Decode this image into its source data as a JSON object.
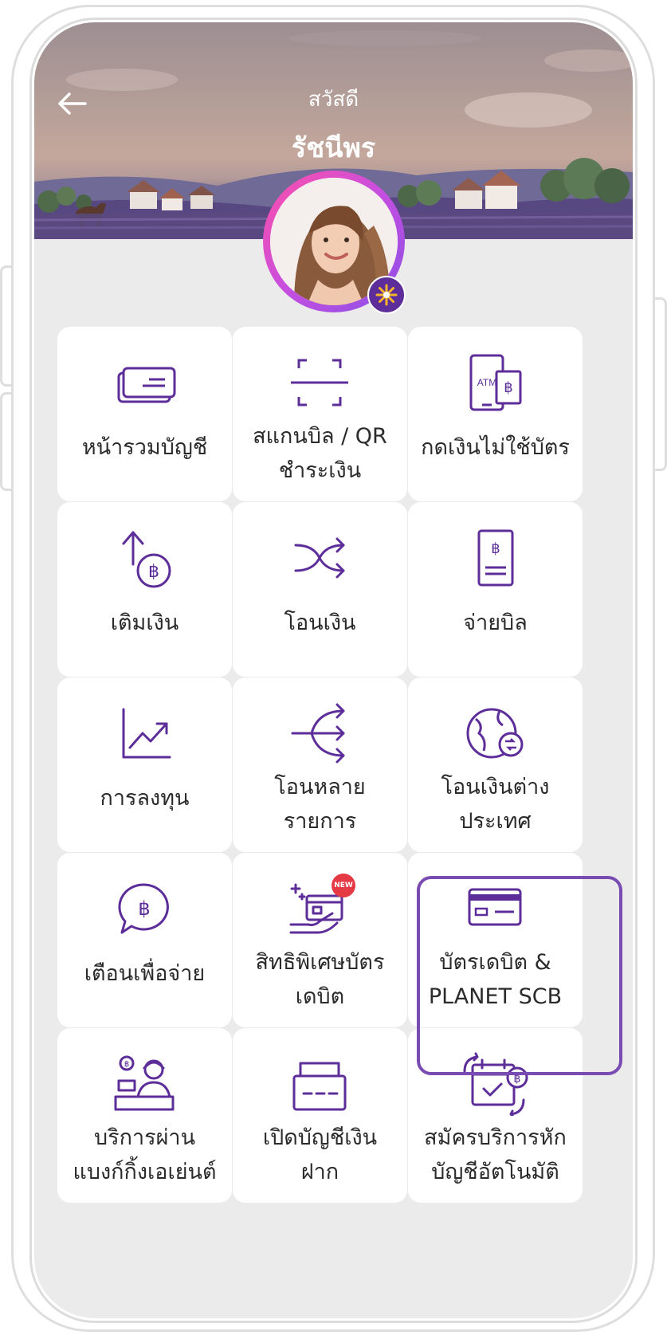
{
  "header": {
    "greeting": "สวัสดี",
    "name": "รัชนีพร"
  },
  "tiles": [
    {
      "label": "หน้ารวมบัญชี",
      "icon": "account-cards-icon"
    },
    {
      "label": "สแกนบิล / QR ชำระเงิน",
      "line1": "สแกนบิล / QR",
      "line2": "ชำระเงิน",
      "icon": "scan-qr-icon"
    },
    {
      "label": "กดเงินไม่ใช้บัตร",
      "icon": "atm-cardless-icon",
      "atm_text": "ATM"
    },
    {
      "label": "เติมเงิน",
      "icon": "top-up-icon"
    },
    {
      "label": "โอนเงิน",
      "icon": "transfer-shuffle-icon"
    },
    {
      "label": "จ่ายบิล",
      "icon": "bill-icon"
    },
    {
      "label": "การลงทุน",
      "icon": "investment-chart-icon"
    },
    {
      "label": "โอนหลาย รายการ",
      "line1": "โอนหลาย",
      "line2": "รายการ",
      "icon": "multi-transfer-icon"
    },
    {
      "label": "โอนเงินต่าง ประเทศ",
      "line1": "โอนเงินต่าง",
      "line2": "ประเทศ",
      "icon": "globe-transfer-icon"
    },
    {
      "label": "เตือนเพื่อจ่าย",
      "icon": "chat-baht-icon"
    },
    {
      "label": "สิทธิพิเศษบัตร เดบิต",
      "line1": "สิทธิพิเศษบัตร",
      "line2": "เดบิต",
      "icon": "debit-privilege-icon",
      "badge": "NEW"
    },
    {
      "label": "บัตรเดบิต & PLANET SCB",
      "line1": "บัตรเดบิต &",
      "line2": "PLANET SCB",
      "icon": "debit-card-icon",
      "selected": true
    },
    {
      "label": "บริการผ่าน แบงก์กิ้งเอเย่นต์",
      "line1": "บริการผ่าน",
      "line2": "แบงก์กิ้งเอเย่นต์",
      "icon": "banking-agent-icon"
    },
    {
      "label": "เปิดบัญชีเงิน ฝาก",
      "line1": "เปิดบัญชีเงิน",
      "line2": "ฝาก",
      "icon": "open-account-icon"
    },
    {
      "label": "สมัครบริการหัก บัญชีอัตโนมัติ",
      "line1": "สมัครบริการหัก",
      "line2": "บัญชีอัตโนมัติ",
      "icon": "auto-debit-calendar-icon"
    }
  ],
  "colors": {
    "accent": "#5d2e9a",
    "highlight": "#7a4bb3",
    "tile_bg": "#ffffff",
    "screen_bg": "#ebebeb",
    "badge_red": "#e63946"
  }
}
